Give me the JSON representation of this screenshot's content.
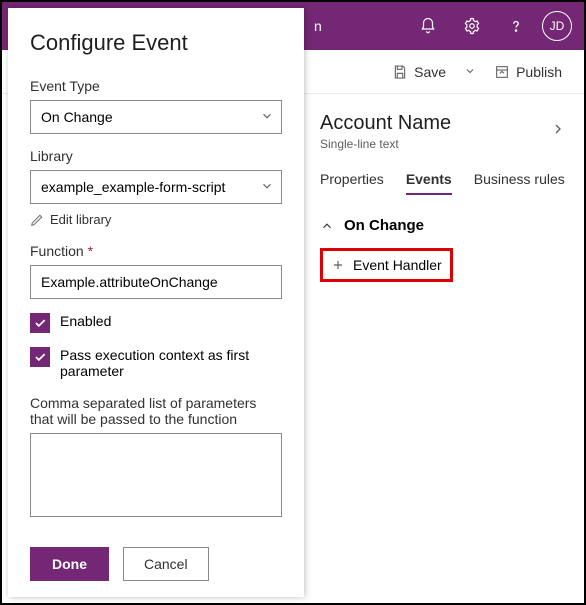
{
  "topbar": {
    "title_fragment": "n",
    "avatar_initials": "JD"
  },
  "commandbar": {
    "save_label": "Save",
    "publish_label": "Publish"
  },
  "field_panel": {
    "title": "Account Name",
    "subtitle": "Single-line text",
    "tabs": {
      "properties": "Properties",
      "events": "Events",
      "rules": "Business rules"
    },
    "section": "On Change",
    "add_label": "Event Handler"
  },
  "configure": {
    "heading": "Configure Event",
    "event_type_label": "Event Type",
    "event_type_value": "On Change",
    "library_label": "Library",
    "library_value": "example_example-form-script",
    "edit_library": "Edit library",
    "function_label": "Function",
    "function_value": "Example.attributeOnChange",
    "enabled_label": "Enabled",
    "pass_context_label": "Pass execution context as first parameter",
    "params_label": "Comma separated list of parameters that will be passed to the function",
    "params_value": "",
    "done": "Done",
    "cancel": "Cancel"
  }
}
